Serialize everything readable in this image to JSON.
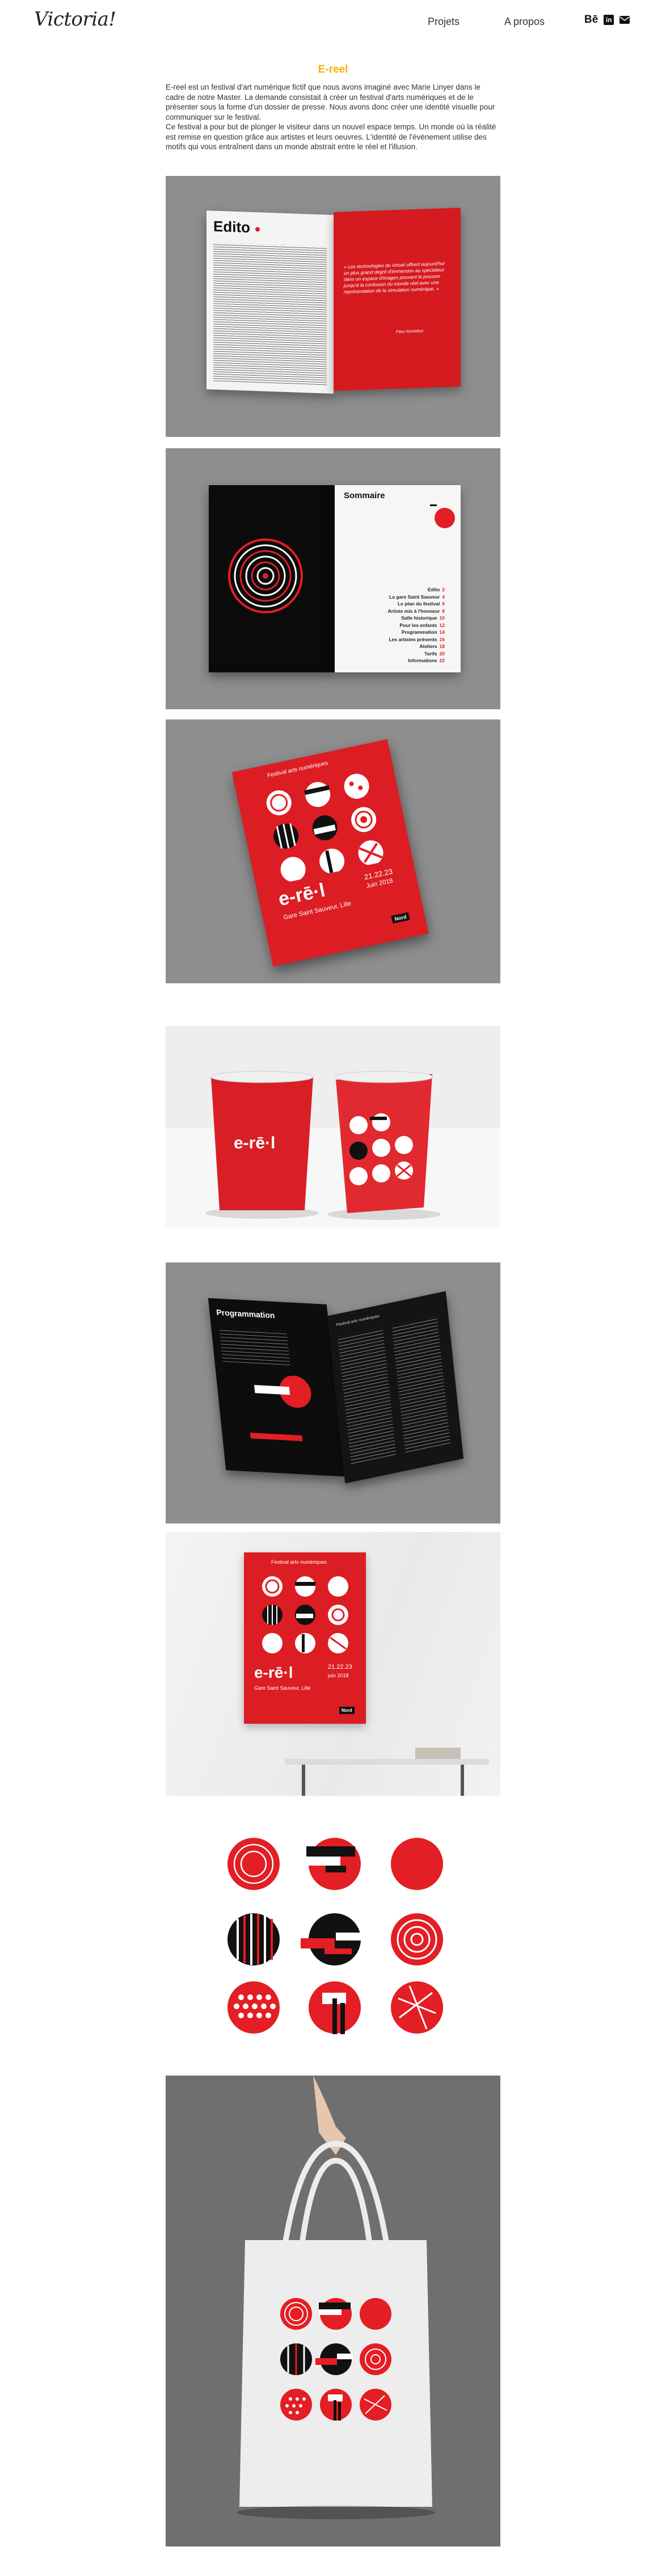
{
  "header": {
    "logo": "Victoria!",
    "nav": {
      "projets": "Projets",
      "apropos": "A propos"
    },
    "socials": {
      "behance": "Bē",
      "linkedin": "in",
      "mail_icon": "envelope-icon"
    }
  },
  "project": {
    "title": "E-reel",
    "description": [
      "E-reel est un festival d'art numérique fictif que nous avons imaginé avec Marie Linyer dans le cadre de notre Master. La demande consistait à créer un festival d'arts numériques et de le présenter sous la forme d'un dossier de presse. Nous avons donc créer une identité visuelle pour communiquer sur le festival.",
      "Ce festival a pour but de plonger le visiteur dans un nouvel espace temps. Un monde où la réalité est remise en question grâce aux artistes et leurs oeuvres. L'identité de l'évènement utilise des motifs qui vous entraînent dans un monde abstrait entre le réel et l'illusion."
    ]
  },
  "mockups": {
    "edito": {
      "heading": "Edito",
      "quote": "« Les technologies du virtuel offrent aujourd'hui un plus grand degré d'immersion au spectateur dans un espace d'images pouvant le pousser jusqu'à la confusion du monde réel avec une représentation de la simulation numérique. »",
      "quote_author": "Fleur Rochefort"
    },
    "sommaire": {
      "heading": "Sommaire",
      "items": [
        {
          "label": "Edito",
          "page": "2"
        },
        {
          "label": "La gare Saint Sauveur",
          "page": "4"
        },
        {
          "label": "Le plan du festival",
          "page": "6"
        },
        {
          "label": "Artiste mis à l'honneur",
          "page": "8"
        },
        {
          "label": "Salle historique",
          "page": "10"
        },
        {
          "label": "Pour les enfants",
          "page": "12"
        },
        {
          "label": "Programmation",
          "page": "14"
        },
        {
          "label": "Les artistes présents",
          "page": "16"
        },
        {
          "label": "Ateliers",
          "page": "18"
        },
        {
          "label": "Tarifs",
          "page": "20"
        },
        {
          "label": "Informations",
          "page": "22"
        }
      ]
    },
    "cover": {
      "subtitle": "Festival arts numériques",
      "logo": "e-rē·l",
      "dates": "21.22.23",
      "month": "Juin 2018",
      "venue": "Gare Saint Sauveur, Lille",
      "badge": "Nord"
    },
    "programmation": {
      "heading": "Programmation",
      "sub": "Festival arts numériques"
    },
    "poster": {
      "subtitle": "Festival arts numériques",
      "logo": "e-rē·l",
      "dates": "21.22.23",
      "month": "juin 2018",
      "venue": "Gare Saint Sauveur, Lille",
      "badge": "Nord"
    }
  },
  "colors": {
    "accent": "#e31e24",
    "title": "#f5b400",
    "mockup_bg": "#8e8e8e"
  }
}
